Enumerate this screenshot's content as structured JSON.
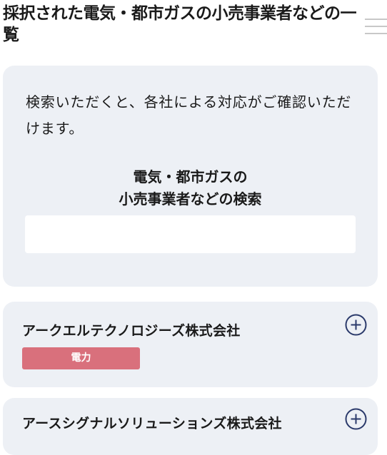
{
  "page": {
    "title": "採択された電気・都市ガスの小売事業者などの一覧"
  },
  "search": {
    "intro": "検索いただくと、各社による対応がご確認いただけます。",
    "heading_line1": "電気・都市ガスの",
    "heading_line2": "小売事業者などの検索",
    "input_value": ""
  },
  "companies": [
    {
      "name": "アークエルテクノロジーズ株式会社",
      "category": "電力"
    },
    {
      "name": "アースシグナルソリューションズ株式会社"
    }
  ],
  "colors": {
    "panel_background": "#edf0f5",
    "badge_electricity": "#d9707c",
    "expand_icon": "#2b3a6b",
    "menu_icon": "#c8c8c8"
  },
  "icons": {
    "menu": "hamburger-menu-icon",
    "expand": "plus-circle-icon"
  }
}
